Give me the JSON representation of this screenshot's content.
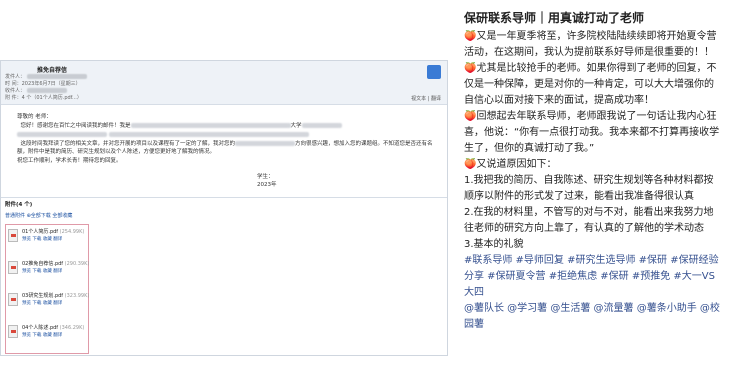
{
  "email": {
    "subject": "推免自荐信",
    "sender_line": "发件人：",
    "date_line": "时 间：2023年6月7日（星期三）",
    "recipient_line": "收件人：",
    "attach_line": "附 件：4 个（01个人简历.pdf...）",
    "tools_label": "视文本 | 翻译",
    "salutation": "尊敬的    老师：",
    "p1": "您好！感谢您在百忙之中阅读我的邮件！我是",
    "p1_tail": "大学",
    "p2": "这段时间我拜读了您的相关文章，并对您开展的项目以及课程有了一定的了解，我对您的",
    "p2_tail": "方向很感兴趣，想加入您的课题组。不知道您是否还有名额，附件中是我的简历、研究生规划以及个人陈述，方便您更好地了解我的情况。",
    "p3": "祝您工作顺利，学术长青！期待您的回复。",
    "sign_student": "学生：",
    "sign_date": "2023年",
    "attach_header": "附件(4 个)",
    "attach_tabs": "普通附件   ⊕全部下载   全部收藏",
    "files": [
      {
        "name": "01个人简历.pdf",
        "size": "(254.99K)",
        "actions": "预览  下载  收藏  翻译"
      },
      {
        "name": "02推免自荐信.pdf",
        "size": "(290.39K)",
        "actions": "预览  下载  收藏  翻译"
      },
      {
        "name": "03研究生规划.pdf",
        "size": "(323.99K)",
        "actions": "预览  下载  收藏  翻译"
      },
      {
        "name": "04个人陈述.pdf",
        "size": "(346.29K)",
        "actions": "预览  下载  收藏  翻译"
      }
    ]
  },
  "post": {
    "title": "保研联系导师｜用真诚打动了老师",
    "para1": "🍑又是一年夏季将至，许多院校陆陆续续即将开始夏令营活动，在这期间，我认为提前联系好导师是很重要的！！🍑尤其是比较抢手的老师。如果你得到了老师的回复，不仅是一种保障，更是对你的一种肯定，可以大大增强你的自信心以面对接下来的面试，提高成功率！",
    "para2": "🍑回想起去年联系导师，老师跟我说了一句话让我内心狂喜，他说：“你有一点很打动我。我本来都不打算再接收学生了，但你的真诚打动了我。”",
    "para3": "🍑又说道原因如下：",
    "list1": "1.我把我的简历、自我陈述、研究生规划等各种材料都按顺序以附件的形式发了过来，能看出我准备得很认真",
    "list2": "2.在我的材料里，不管写的对与不对，能看出来我努力地往老师的研究方向上靠了，有认真的了解他的学术动态",
    "list3": "3.基本的礼貌",
    "tags": "#联系导师 #导师回复 #研究生选导师 #保研 #保研经验分享 #保研夏令营 #拒绝焦虑 #保研 #预推免 #大一VS大四",
    "mentions": "@薯队长 @学习薯 @生活薯 @流量薯 @薯条小助手 @校园薯"
  }
}
